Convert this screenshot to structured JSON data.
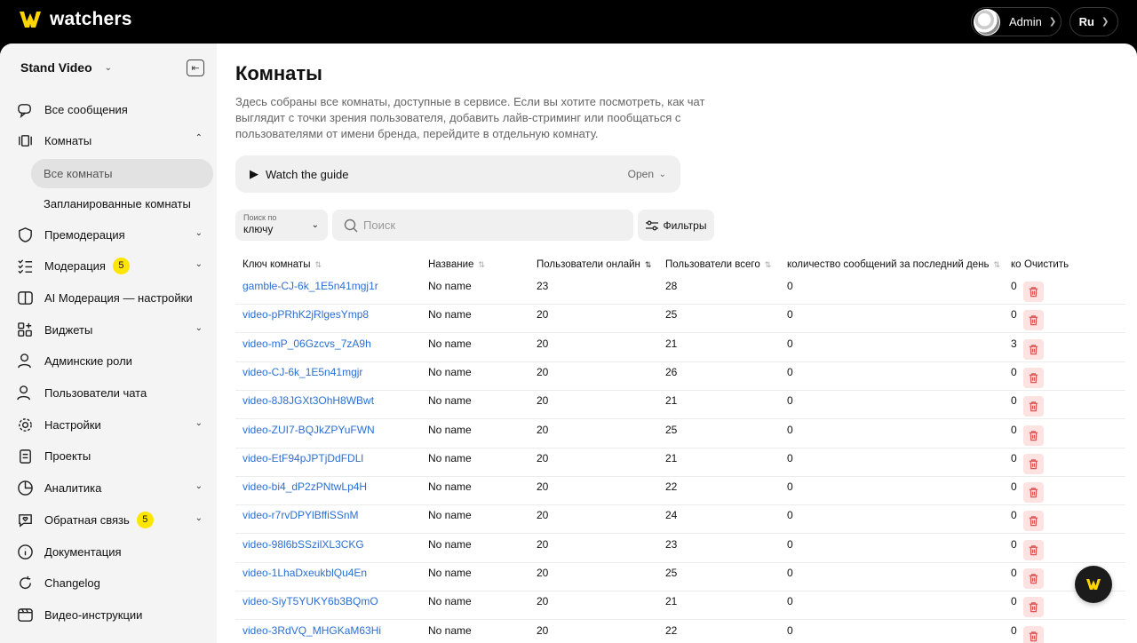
{
  "brand": {
    "name": "watchers",
    "accent": "#ffd500"
  },
  "header": {
    "user": "Admin",
    "language": "Ru"
  },
  "sidebar": {
    "project": "Stand Video",
    "items": [
      {
        "label": "Все сообщения",
        "icon": "messages-icon"
      },
      {
        "label": "Комнаты",
        "icon": "rooms-icon"
      },
      {
        "label": "Премодерация",
        "icon": "shield-icon"
      },
      {
        "label": "Модерация",
        "icon": "checklist-icon",
        "badge": "5"
      },
      {
        "label": "AI Модерация — настройки",
        "icon": "ai-icon"
      },
      {
        "label": "Виджеты",
        "icon": "widgets-icon"
      },
      {
        "label": "Админские роли",
        "icon": "user-icon"
      },
      {
        "label": "Пользователи чата",
        "icon": "users-icon"
      },
      {
        "label": "Настройки",
        "icon": "gear-icon"
      },
      {
        "label": "Проекты",
        "icon": "clipboard-icon"
      },
      {
        "label": "Аналитика",
        "icon": "pie-chart-icon"
      },
      {
        "label": "Обратная связь",
        "icon": "feedback-icon",
        "badge": "5"
      },
      {
        "label": "Документация",
        "icon": "info-icon"
      },
      {
        "label": "Changelog",
        "icon": "refresh-icon"
      },
      {
        "label": "Видео-инструкции",
        "icon": "video-icon"
      }
    ],
    "subitems": [
      {
        "label": "Все комнаты"
      },
      {
        "label": "Запланированные комнаты"
      }
    ]
  },
  "main": {
    "title": "Комнаты",
    "description": "Здесь собраны все комнаты, доступные в сервисе. Если вы хотите посмотреть, как чат выглядит с точки зрения пользователя, добавить лайв-стриминг или пообщаться с пользователями от имени бренда, перейдите в отдельную комнату.",
    "guide": {
      "label": "Watch the guide",
      "action": "Open"
    },
    "search_by": {
      "label": "Поиск по",
      "value": "ключу"
    },
    "search": {
      "placeholder": "Поиск"
    },
    "filters_label": "Фильтры"
  },
  "table": {
    "columns": [
      "Ключ комнаты",
      "Название",
      "Пользователи онлайн",
      "Пользователи всего",
      "количество сообщений за последний день",
      "ко",
      "Очистить"
    ],
    "rows": [
      {
        "key": "gamble-CJ-6k_1E5n41mgj1r",
        "name": "No name",
        "online": "23",
        "total": "28",
        "messages": "0",
        "extra": "0"
      },
      {
        "key": "video-pPRhK2jRlgesYmp8",
        "name": "No name",
        "online": "20",
        "total": "25",
        "messages": "0",
        "extra": "0"
      },
      {
        "key": "video-mP_06Gzcvs_7zA9h",
        "name": "No name",
        "online": "20",
        "total": "21",
        "messages": "0",
        "extra": "3"
      },
      {
        "key": "video-CJ-6k_1E5n41mgjr",
        "name": "No name",
        "online": "20",
        "total": "26",
        "messages": "0",
        "extra": "0"
      },
      {
        "key": "video-8J8JGXt3OhH8WBwt",
        "name": "No name",
        "online": "20",
        "total": "21",
        "messages": "0",
        "extra": "0"
      },
      {
        "key": "video-ZUI7-BQJkZPYuFWN",
        "name": "No name",
        "online": "20",
        "total": "25",
        "messages": "0",
        "extra": "0"
      },
      {
        "key": "video-EtF94pJPTjDdFDLl",
        "name": "No name",
        "online": "20",
        "total": "21",
        "messages": "0",
        "extra": "0"
      },
      {
        "key": "video-bi4_dP2zPNtwLp4H",
        "name": "No name",
        "online": "20",
        "total": "22",
        "messages": "0",
        "extra": "0"
      },
      {
        "key": "video-r7rvDPYlBffiSSnM",
        "name": "No name",
        "online": "20",
        "total": "24",
        "messages": "0",
        "extra": "0"
      },
      {
        "key": "video-98l6bSSzilXL3CKG",
        "name": "No name",
        "online": "20",
        "total": "23",
        "messages": "0",
        "extra": "0"
      },
      {
        "key": "video-1LhaDxeukblQu4En",
        "name": "No name",
        "online": "20",
        "total": "25",
        "messages": "0",
        "extra": "0"
      },
      {
        "key": "video-SiyT5YUKY6b3BQmO",
        "name": "No name",
        "online": "20",
        "total": "21",
        "messages": "0",
        "extra": "0"
      },
      {
        "key": "video-3RdVQ_MHGKaM63Hi",
        "name": "No name",
        "online": "20",
        "total": "22",
        "messages": "0",
        "extra": "0"
      }
    ]
  }
}
